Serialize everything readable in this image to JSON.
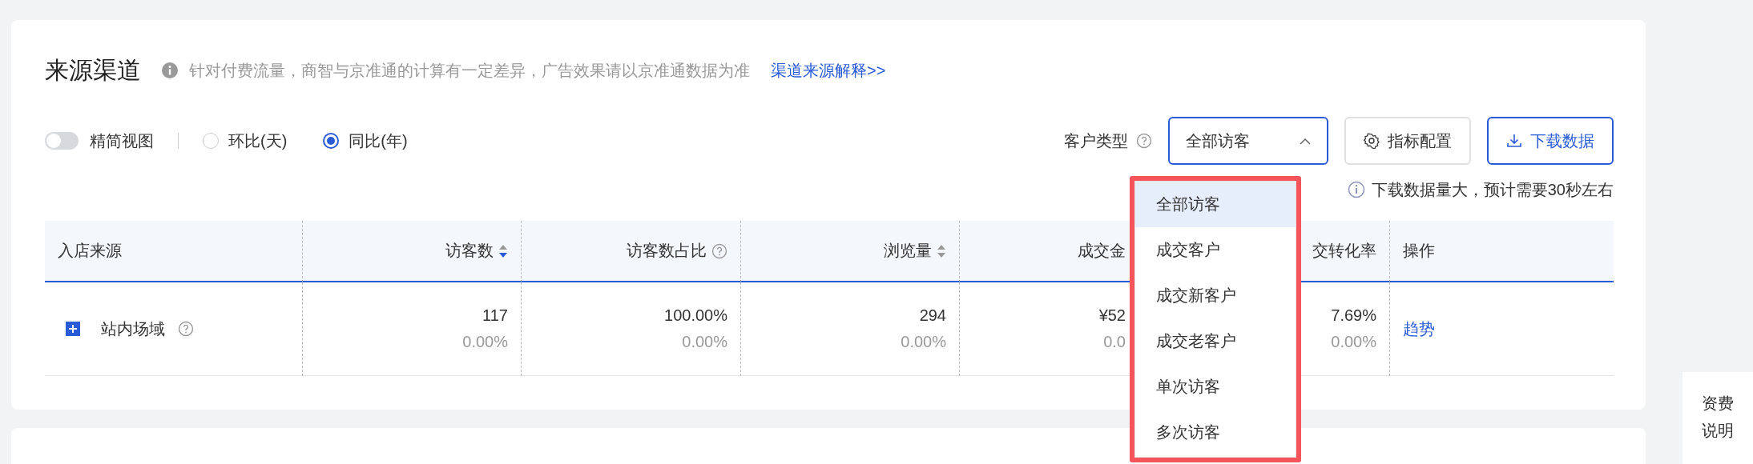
{
  "header": {
    "title": "来源渠道",
    "notice": "针对付费流量，商智与京准通的计算有一定差异，广告效果请以京准通数据为准",
    "link": "渠道来源解释>>"
  },
  "toolbar": {
    "simple_view": {
      "label": "精简视图",
      "on": false
    },
    "compare": [
      {
        "label": "环比(天)",
        "selected": false
      },
      {
        "label": "同比(年)",
        "selected": true
      }
    ],
    "customer_type": {
      "label": "客户类型",
      "value": "全部访客",
      "expanded": true
    },
    "buttons": [
      {
        "kind": "config",
        "label": "指标配置"
      },
      {
        "kind": "download",
        "label": "下载数据"
      }
    ],
    "download_note": "下载数据量大，预计需要30秒左右"
  },
  "dropdown": [
    {
      "label": "全部访客",
      "selected": true
    },
    {
      "label": "成交客户",
      "selected": false
    },
    {
      "label": "成交新客户",
      "selected": false
    },
    {
      "label": "成交老客户",
      "selected": false
    },
    {
      "label": "单次访客",
      "selected": false
    },
    {
      "label": "多次访客",
      "selected": false
    }
  ],
  "table": {
    "columns": [
      {
        "label": "入店来源",
        "help": false,
        "sortable": false
      },
      {
        "label": "访客数",
        "help": false,
        "sortable": true,
        "sorted": true
      },
      {
        "label": "访客数占比",
        "help": true,
        "sortable": false
      },
      {
        "label": "浏览量",
        "help": false,
        "sortable": true,
        "sorted": false
      },
      {
        "label": "成交金",
        "help": false,
        "sortable": false
      },
      {
        "label": "交转化率",
        "help": false,
        "sortable": false
      },
      {
        "label": "操作",
        "help": false,
        "sortable": false
      }
    ],
    "rows": [
      {
        "cells": [
          {
            "kind": "source",
            "text": "站内场域",
            "expanded": false
          },
          {
            "kind": "metric",
            "value": "117",
            "change": "0.00%"
          },
          {
            "kind": "metric",
            "value": "100.00%",
            "change": "0.00%"
          },
          {
            "kind": "metric",
            "value": "294",
            "change": "0.00%"
          },
          {
            "kind": "metric",
            "value": "¥52",
            "change": "0.0"
          },
          {
            "kind": "metric",
            "value": "7.69%",
            "change": "0.00%"
          },
          {
            "kind": "action",
            "text": "趋势"
          }
        ]
      }
    ]
  },
  "side_panel": {
    "label": "资费说明"
  }
}
